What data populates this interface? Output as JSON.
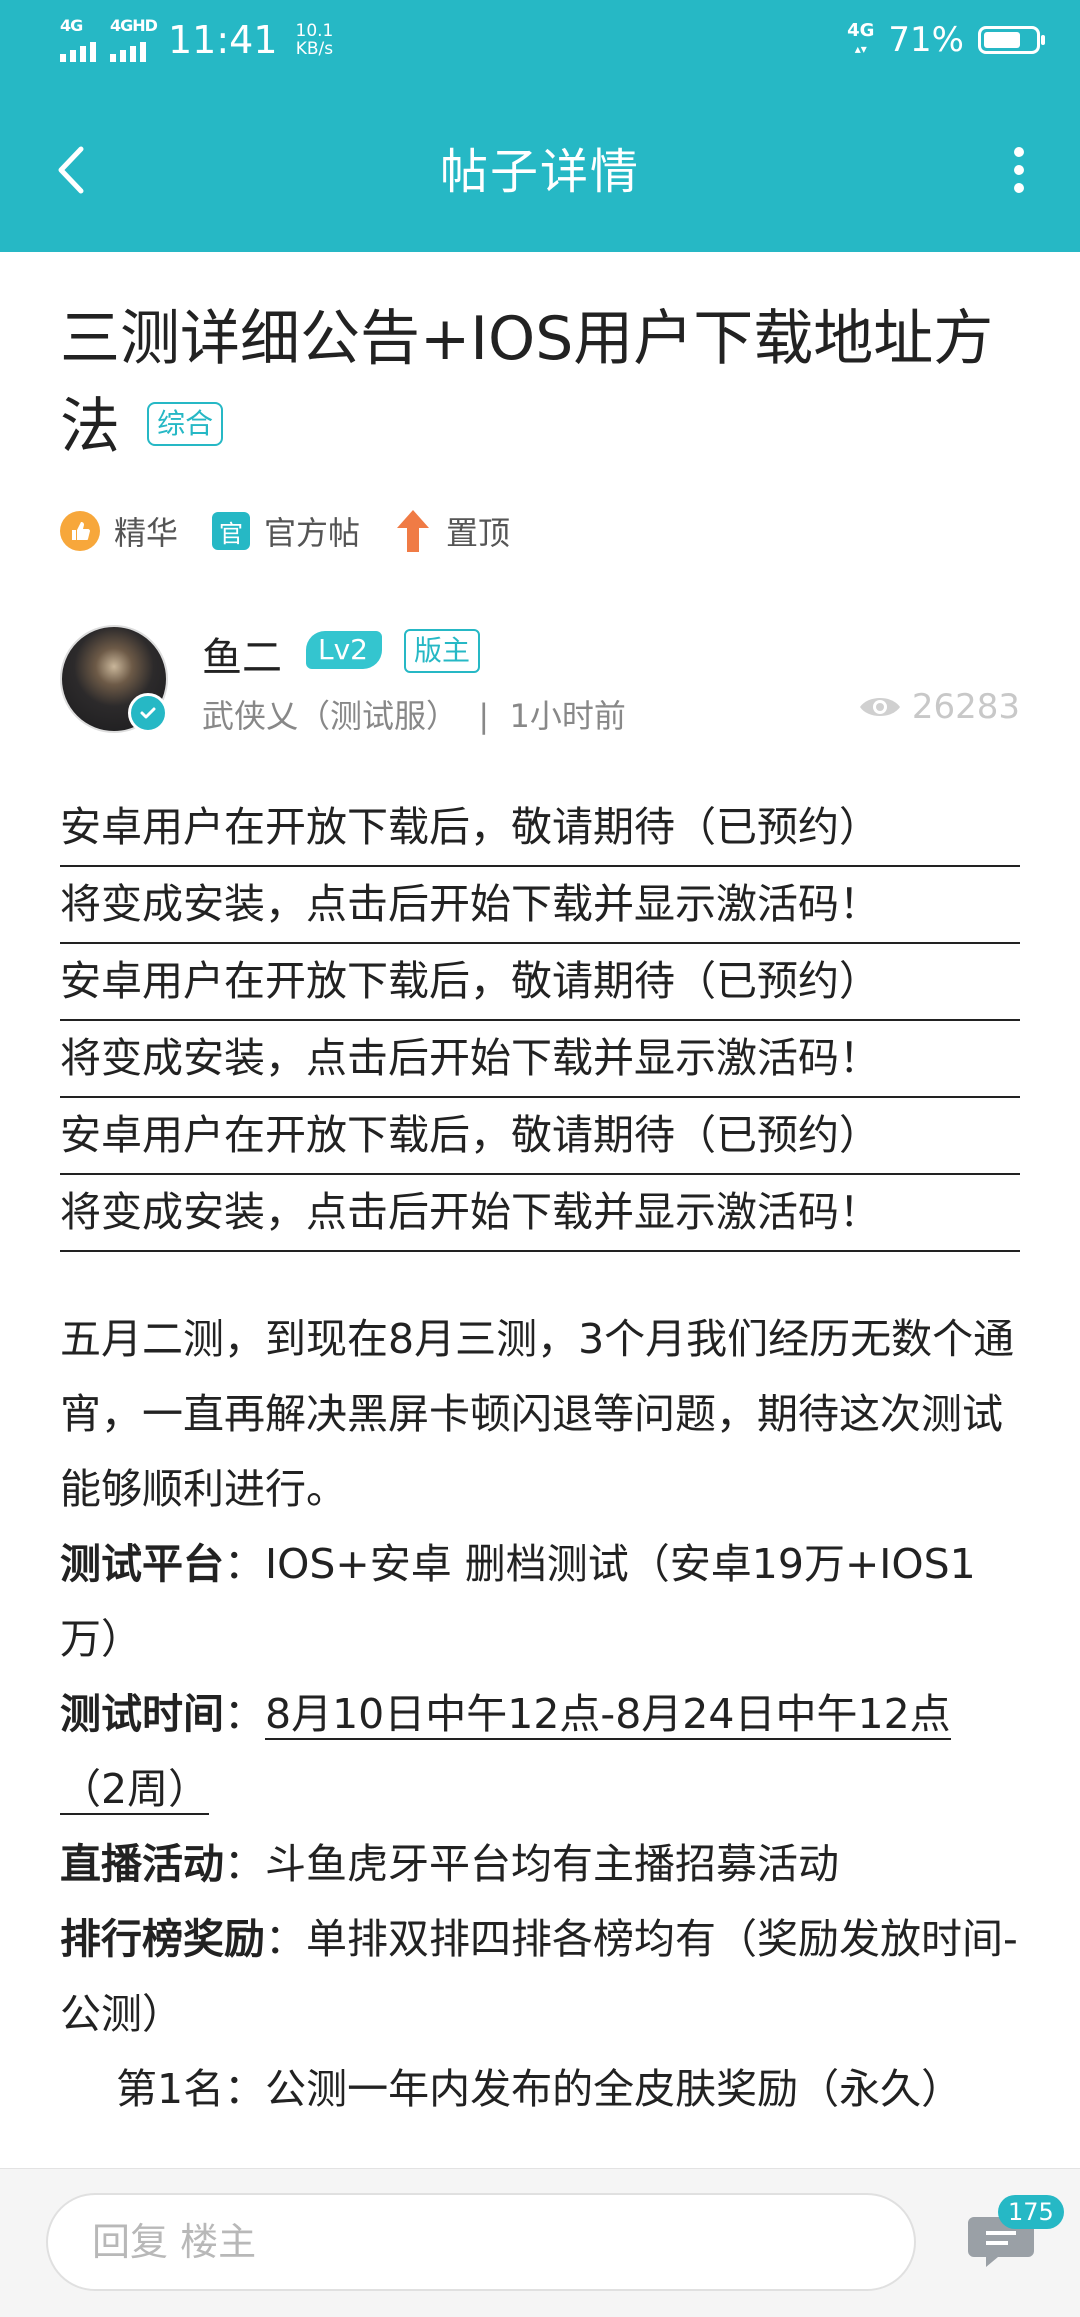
{
  "status_bar": {
    "signal1": "4G",
    "signal2": "4GHD",
    "time": "11:41",
    "speed_value": "10.1",
    "speed_unit": "KB/s",
    "net_label": "4G",
    "battery_percent": "71%",
    "battery_level": 0.71
  },
  "header": {
    "title": "帖子详情"
  },
  "post": {
    "title": "三测详细公告+IOS用户下载地址方法",
    "category": "综合",
    "badges": {
      "essence": "精华",
      "official_icon": "官",
      "official": "官方帖",
      "pinned": "置顶"
    }
  },
  "author": {
    "name": "鱼二",
    "level": "Lv2",
    "role": "版主",
    "server": "武侠乂（测试服）",
    "separator": "|",
    "time": "1小时前",
    "views": "26283"
  },
  "content": {
    "repeated_lines": [
      "安卓用户在开放下载后，敬请期待（已预约）",
      "将变成安装，点击后开始下载并显示激活码！",
      "安卓用户在开放下载后，敬请期待（已预约）",
      "将变成安装，点击后开始下载并显示激活码！",
      "安卓用户在开放下载后，敬请期待（已预约）",
      "将变成安装，点击后开始下载并显示激活码！"
    ],
    "intro": "五月二测，到现在8月三测，3个月我们经历无数个通宵，一直再解决黑屏卡顿闪退等问题，期待这次测试能够顺利进行。",
    "platform_label": "测试平台",
    "platform_value": "IOS+安卓 删档测试（安卓19万+IOS1万）",
    "time_label": "测试时间",
    "time_value": "8月10日中午12点-8月24日中午12点 （2周）",
    "live_label": "直播活动",
    "live_value": "斗鱼虎牙平台均有主播招募活动",
    "rank_label": "排行榜奖励",
    "rank_value": "单排双排四排各榜均有（奖励发放时间-公测）",
    "first_prize": "第1名：公测一年内发布的全皮肤奖励（永久）",
    "colon": "："
  },
  "bottom_bar": {
    "reply_placeholder": "回复  楼主",
    "comment_count": "175"
  }
}
